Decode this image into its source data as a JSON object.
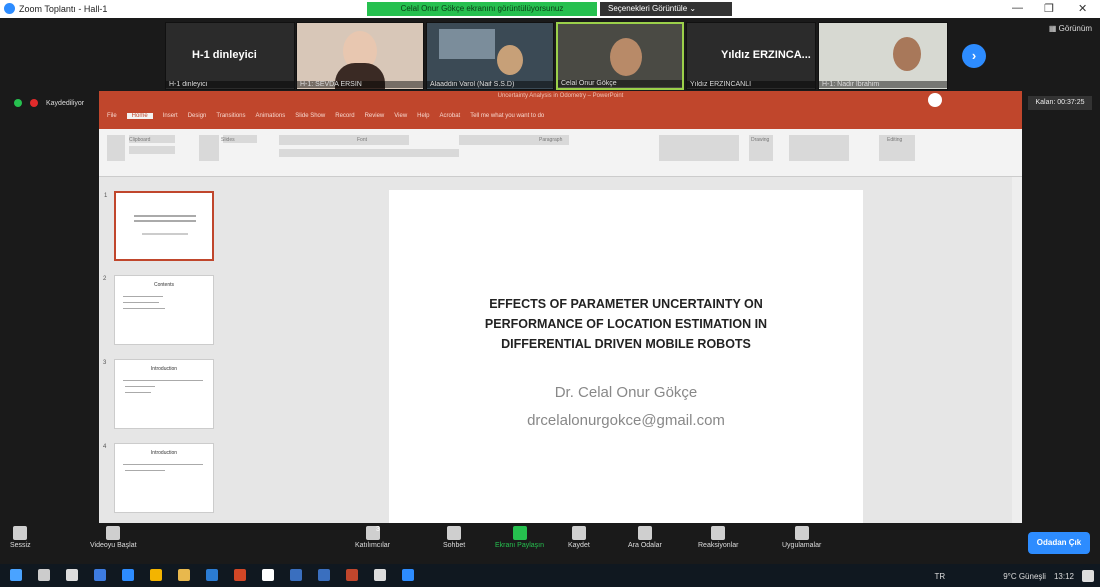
{
  "window": {
    "title": "Zoom Toplantı - Hall-1"
  },
  "share_banner": {
    "text": "Celal Onur Gökçe ekranını görüntülüyorsunuz",
    "view_options": "Seçenekleri Görüntüle"
  },
  "speaker_view": "Görünüm",
  "participants": [
    {
      "big": "H-1 dinleyici",
      "name": "H-1 dinleyici"
    },
    {
      "name": "H-1: SEVDA ERSİN"
    },
    {
      "name": "Alaaddin Varol (Naif S.S.D)"
    },
    {
      "name": "Celal Onur Gökçe"
    },
    {
      "big": "Yıldız ERZINCA...",
      "name": "Yıldız ERZİNCANLI"
    },
    {
      "name": "H-1: Nadir Ibrahim"
    }
  ],
  "recording": {
    "label": "Kaydediliyor"
  },
  "timer": "Kalan: 00:37:25",
  "ppt": {
    "titlebar": "Uncertainty Analysis in Odometry – PowerPoint",
    "tabs": [
      "File",
      "Home",
      "Insert",
      "Design",
      "Transitions",
      "Animations",
      "Slide Show",
      "Record",
      "Review",
      "View",
      "Help",
      "Acrobat",
      "Tell me what you want to do"
    ],
    "groups": [
      "Clipboard",
      "Slides",
      "Font",
      "Paragraph",
      "Drawing",
      "Editing"
    ],
    "slide_numbers": [
      "1",
      "2",
      "3",
      "4"
    ],
    "thumb_titles": [
      "",
      "Contents",
      "Introduction",
      "Introduction"
    ]
  },
  "slide": {
    "title_lines": [
      "EFFECTS OF PARAMETER UNCERTAINTY ON",
      "PERFORMANCE OF LOCATION ESTIMATION IN",
      "DIFFERENTIAL DRIVEN MOBILE ROBOTS"
    ],
    "author": "Dr. Celal Onur Gökçe",
    "email": "drcelalonurgokce@gmail.com"
  },
  "toolbar": {
    "audio": "Sessiz",
    "video": "Videoyu Başlat",
    "participants": "Katılımcılar",
    "participants_count": "3",
    "chat": "Sohbet",
    "share": "Ekranı Paylaşın",
    "record": "Kaydet",
    "breakout": "Ara Odalar",
    "reactions": "Reaksiyonlar",
    "apps": "Uygulamalar",
    "leave": "Odadan Çık"
  },
  "taskbar": {
    "lang": "TR",
    "weather": "9°C Güneşli",
    "time": "13:12"
  }
}
